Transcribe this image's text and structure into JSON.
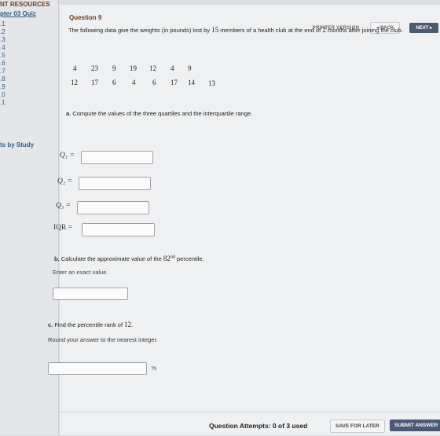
{
  "sidebar": {
    "header": "NT RESOURCES",
    "quiz": "pter 03 Quiz",
    "links": [
      ".1",
      ".2",
      ".3",
      ".4",
      ".5",
      ".6",
      ".7",
      ".8",
      ".9",
      ".0",
      ".1"
    ],
    "study": "ts by Study"
  },
  "question": {
    "title": "Question 9",
    "printer": "PRINTER VERSION",
    "back": "◂ BACK",
    "next": "NEXT ▸",
    "text_before": "The following data give the weights (in pounds) lost by ",
    "text_n": "15",
    "text_mid": " members of a health club at the end of ",
    "text_m": "2",
    "text_after": " months after joining the club.",
    "data_row1": [
      "4",
      "23",
      "9",
      "19",
      "12",
      "4",
      "9"
    ],
    "data_row2": [
      "12",
      "17",
      "6",
      "4",
      "6",
      "17",
      "14"
    ],
    "data_extra": "13"
  },
  "part_a": {
    "prompt_letter": "a.",
    "prompt": " Compute the values of the three quartiles and the interquartile range.",
    "labels": {
      "q1": "Q₁ =",
      "q2": "Q₂ =",
      "q3": "Q₃ =",
      "iqr": "IQR ="
    },
    "values": {
      "q1": "",
      "q2": "",
      "q3": "",
      "iqr": ""
    }
  },
  "part_b": {
    "prompt_letter": "b.",
    "prompt_pre": " Calculate the approximate value of the ",
    "pct_num": "82",
    "pct_sup": "nd",
    "prompt_post": " percentile.",
    "hint": "Enter an exact value.",
    "value": ""
  },
  "part_c": {
    "prompt_letter": "c.",
    "prompt_pre": " Find the percentile rank of ",
    "value_num": "12",
    "prompt_post": ".",
    "hint": "Round your answer to the nearest integer.",
    "value": "",
    "unit": "%"
  },
  "footer": {
    "attempts": "Question Attempts: 0 of 3 used",
    "save": "SAVE FOR LATER",
    "submit": "SUBMIT ANSWER"
  }
}
